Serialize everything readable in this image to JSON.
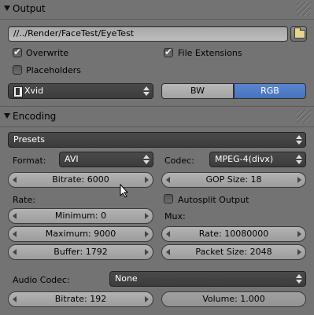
{
  "output": {
    "title": "Output",
    "path": "//../Render/FaceTest/EyeTest",
    "overwrite": {
      "label": "Overwrite",
      "checked": true
    },
    "file_extensions": {
      "label": "File Extensions",
      "checked": true
    },
    "placeholders": {
      "label": "Placeholders",
      "checked": false
    },
    "format_menu": "Xvid",
    "color_bw": "BW",
    "color_rgb": "RGB",
    "selected_color": "RGB"
  },
  "encoding": {
    "title": "Encoding",
    "presets": "Presets",
    "format_label": "Format:",
    "format_value": "AVI",
    "codec_label": "Codec:",
    "codec_value": "MPEG-4(divx)",
    "bitrate": "Bitrate: 6000",
    "gop_size": "GOP Size: 18",
    "rate_label": "Rate:",
    "autosplit": {
      "label": "Autosplit Output",
      "checked": false
    },
    "minimum": "Minimum: 0",
    "mux_label": "Mux:",
    "maximum": "Maximum: 9000",
    "mux_rate": "Rate: 10080000",
    "buffer": "Buffer: 1792",
    "packet_size": "Packet Size: 2048",
    "audio_codec_label": "Audio Codec:",
    "audio_codec_value": "None",
    "audio_bitrate": "Bitrate: 192",
    "volume": "Volume: 1.000"
  },
  "colors": {
    "background": "#737373",
    "selected": "#4f7ac4"
  }
}
